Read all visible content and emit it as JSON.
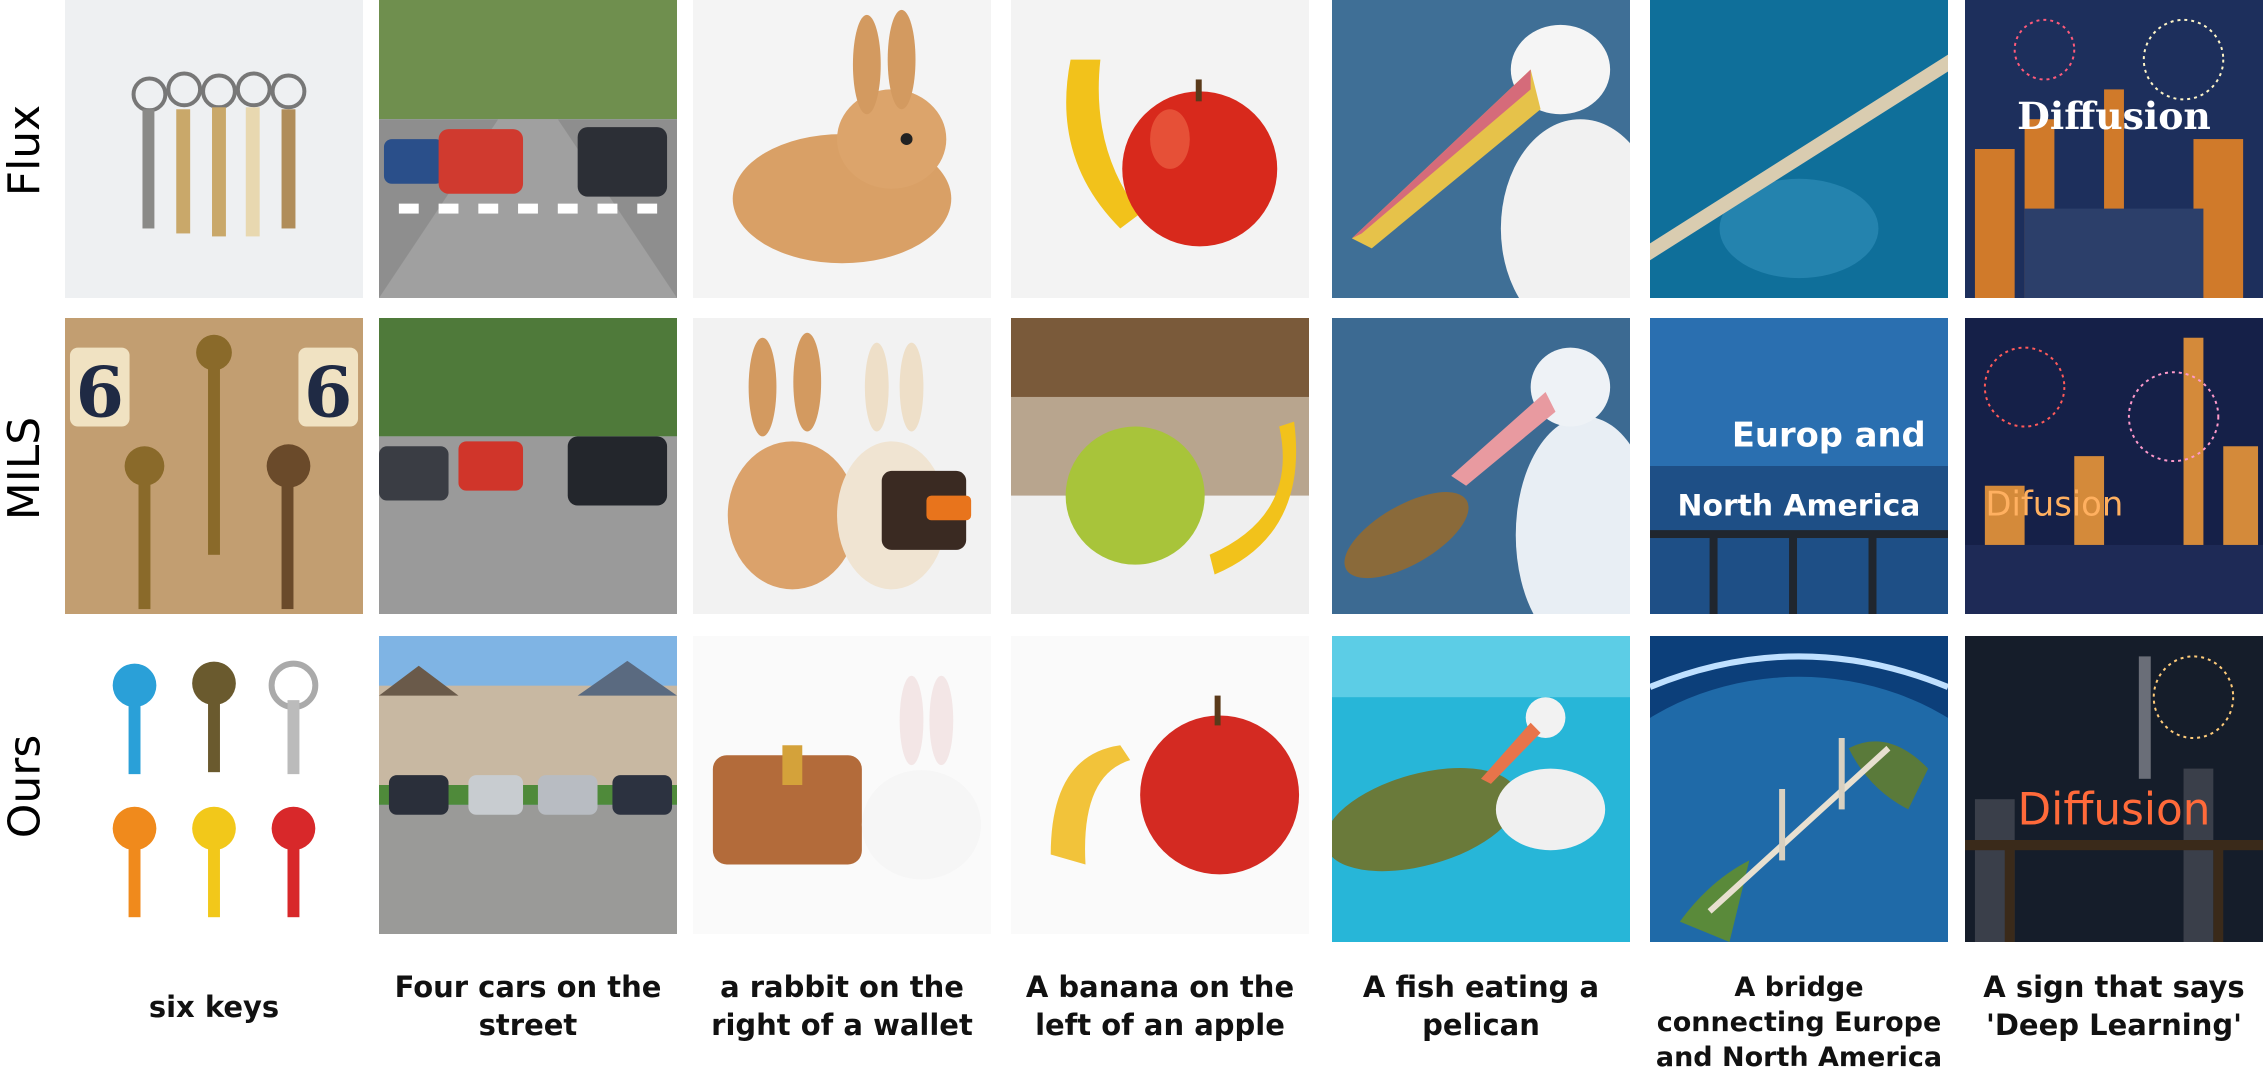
{
  "rows": [
    {
      "label": "Flux"
    },
    {
      "label": "MILS"
    },
    {
      "label": "Ours"
    }
  ],
  "captions": [
    "six keys",
    "Four cars on the street",
    "a rabbit on the right of a wallet",
    "A banana on the left of an apple",
    "A fish eating a pelican",
    "A bridge connecting Europe and North America",
    "A sign that says 'Deep Learning'"
  ],
  "image_text": {
    "flux_sign": "Diffusion",
    "mils_bridge_line1": "Europ and",
    "mils_bridge_line2": "North America",
    "mils_sign": "Difusion",
    "ours_sign": "Diffusion"
  },
  "colors": {
    "background": "#ffffff",
    "label": "#000000",
    "caption": "#111111"
  }
}
